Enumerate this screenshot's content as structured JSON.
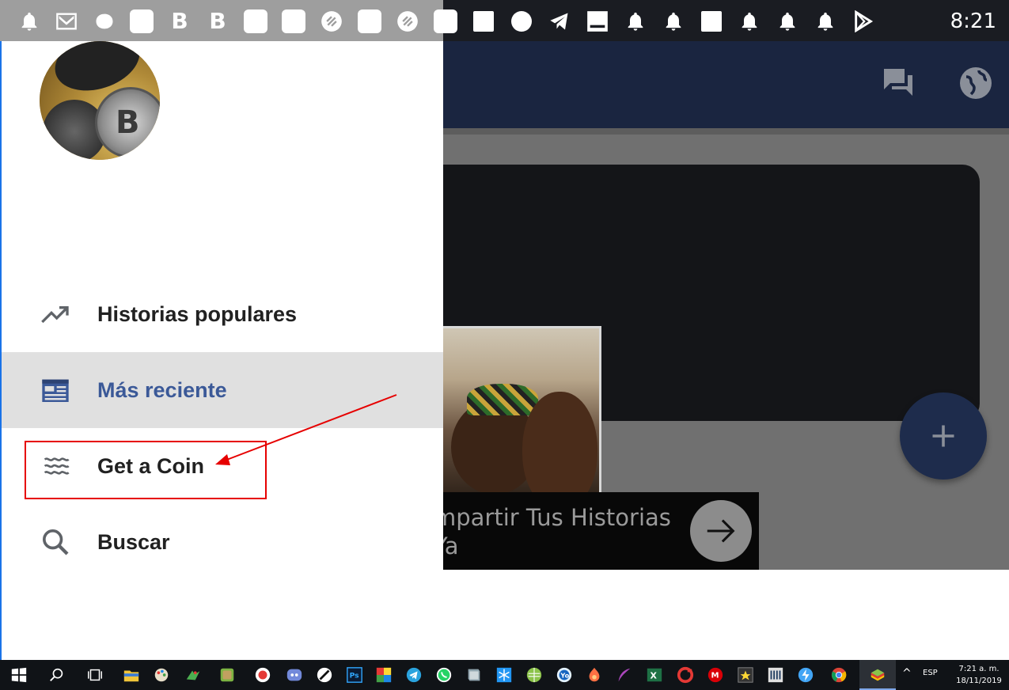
{
  "status_bar": {
    "clock": "8:21",
    "icons": [
      "bell-icon",
      "gmail-icon",
      "cat-icon",
      "blank-app-icon",
      "b-app-icon",
      "b-app-icon",
      "blank-app-icon",
      "blank-app-icon",
      "electroneum-icon",
      "blank-app-icon",
      "electroneum-icon",
      "blank-app-icon",
      "square-icon",
      "circle-icon",
      "telegram-icon",
      "image-icon",
      "bell-icon",
      "bell-icon",
      "square-icon",
      "bell-icon",
      "bell-icon",
      "bell-icon",
      "play-store-icon"
    ],
    "letters": {
      "b_app": "B"
    }
  },
  "drawer": {
    "menu": [
      {
        "label": "Historias populares",
        "icon": "trending-up-icon",
        "selected": false
      },
      {
        "label": "Más reciente",
        "icon": "newspaper-icon",
        "selected": true
      },
      {
        "label": "Get a Coin",
        "icon": "waves-icon",
        "selected": false
      },
      {
        "label": "Buscar",
        "icon": "search-icon",
        "selected": false
      }
    ]
  },
  "background": {
    "share_text_line1": "mpartir Tus Historias",
    "share_text_line2": "Ya",
    "fab_icon": "plus-icon",
    "appbar_icons": [
      "chat-icon",
      "globe-icon"
    ]
  },
  "colors": {
    "appbar": "#1a2540",
    "drawer_selected_text": "#3b5998",
    "annotation": "#e60000"
  },
  "taskbar": {
    "language": "ESP",
    "time": "7:21 a. m.",
    "date": "18/11/2019"
  }
}
